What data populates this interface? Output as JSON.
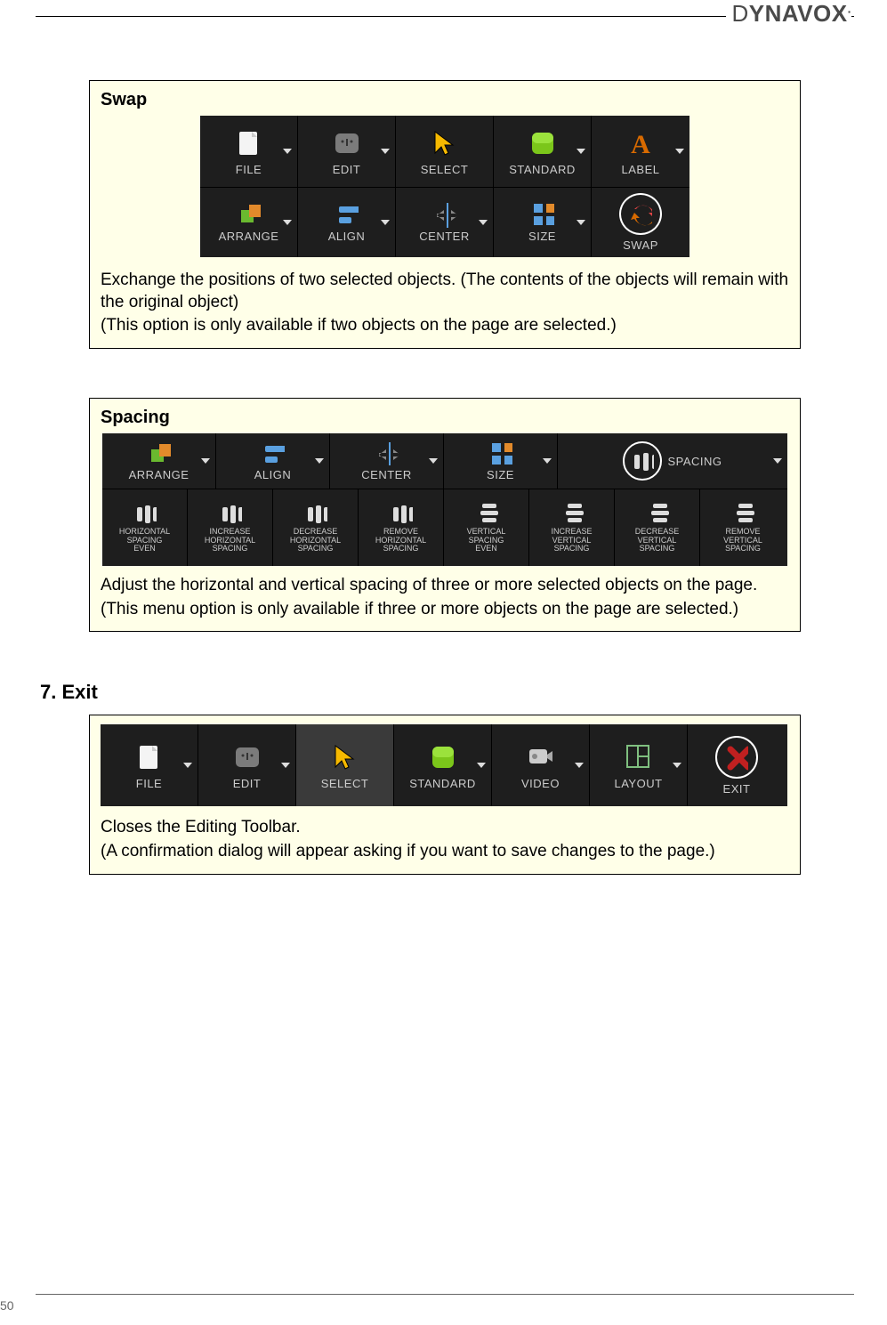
{
  "brand": {
    "thin": "D",
    "bold": "YNAVOX",
    "dot": "."
  },
  "page_number": "50",
  "swap": {
    "title": "Swap",
    "toolbar": {
      "row1": [
        {
          "label": "FILE",
          "icon": "file-icon",
          "chev": true
        },
        {
          "label": "EDIT",
          "icon": "edit-icon",
          "chev": true
        },
        {
          "label": "SELECT",
          "icon": "select-arrow-icon",
          "chev": false
        },
        {
          "label": "STANDARD",
          "icon": "standard-tile-icon",
          "chev": true
        },
        {
          "label": "LABEL",
          "icon": "label-a-icon",
          "chev": true
        }
      ],
      "row2": [
        {
          "label": "ARRANGE",
          "icon": "arrange-icon",
          "chev": true
        },
        {
          "label": "ALIGN",
          "icon": "align-icon",
          "chev": true
        },
        {
          "label": "CENTER",
          "icon": "center-icon",
          "chev": true
        },
        {
          "label": "SIZE",
          "icon": "size-icon",
          "chev": true
        },
        {
          "label": "SWAP",
          "icon": "swap-icon",
          "circled": true,
          "chev": false
        }
      ]
    },
    "desc1": "Exchange the positions of two selected objects. (The contents of the objects will remain with the original object)",
    "desc2": "(This option is only available if two objects on the page are selected.)"
  },
  "spacing": {
    "title": "Spacing",
    "toolbar": {
      "row1": [
        {
          "label": "ARRANGE",
          "icon": "arrange-icon",
          "chev": true
        },
        {
          "label": "ALIGN",
          "icon": "align-icon",
          "chev": true
        },
        {
          "label": "CENTER",
          "icon": "center-icon",
          "chev": true
        },
        {
          "label": "SIZE",
          "icon": "size-icon",
          "chev": true
        },
        {
          "label": "SPACING",
          "icon": "spacing-icon",
          "circled": true,
          "chev": true
        }
      ],
      "row2": [
        {
          "label": "HORIZONTAL\nSPACING\nEVEN",
          "icon": "h-space-even-icon"
        },
        {
          "label": "INCREASE\nHORIZONTAL\nSPACING",
          "icon": "h-space-inc-icon"
        },
        {
          "label": "DECREASE\nHORIZONTAL\nSPACING",
          "icon": "h-space-dec-icon"
        },
        {
          "label": "REMOVE\nHORIZONTAL\nSPACING",
          "icon": "h-space-rem-icon"
        },
        {
          "label": "VERTICAL\nSPACING\nEVEN",
          "icon": "v-space-even-icon"
        },
        {
          "label": "INCREASE\nVERTICAL\nSPACING",
          "icon": "v-space-inc-icon"
        },
        {
          "label": "DECREASE\nVERTICAL\nSPACING",
          "icon": "v-space-dec-icon"
        },
        {
          "label": "REMOVE\nVERTICAL\nSPACING",
          "icon": "v-space-rem-icon"
        }
      ]
    },
    "desc1": "Adjust the horizontal and vertical spacing of three or more selected objects on the page.",
    "desc2": "(This menu option is only available if three or more objects on the page are selected.)"
  },
  "exit": {
    "heading": "7. Exit",
    "toolbar": {
      "row": [
        {
          "label": "FILE",
          "icon": "file-icon",
          "chev": true
        },
        {
          "label": "EDIT",
          "icon": "edit-icon",
          "chev": true
        },
        {
          "label": "SELECT",
          "icon": "select-arrow-icon",
          "chev": false,
          "selected": true
        },
        {
          "label": "STANDARD",
          "icon": "standard-tile-icon",
          "chev": true
        },
        {
          "label": "VIDEO",
          "icon": "video-icon",
          "chev": true
        },
        {
          "label": "LAYOUT",
          "icon": "layout-icon",
          "chev": true
        },
        {
          "label": "EXIT",
          "icon": "exit-x-icon",
          "circled": true,
          "chev": false
        }
      ]
    },
    "desc1": "Closes the Editing Toolbar.",
    "desc2": "(A confirmation dialog will appear asking if you want to save changes to the page.)"
  }
}
